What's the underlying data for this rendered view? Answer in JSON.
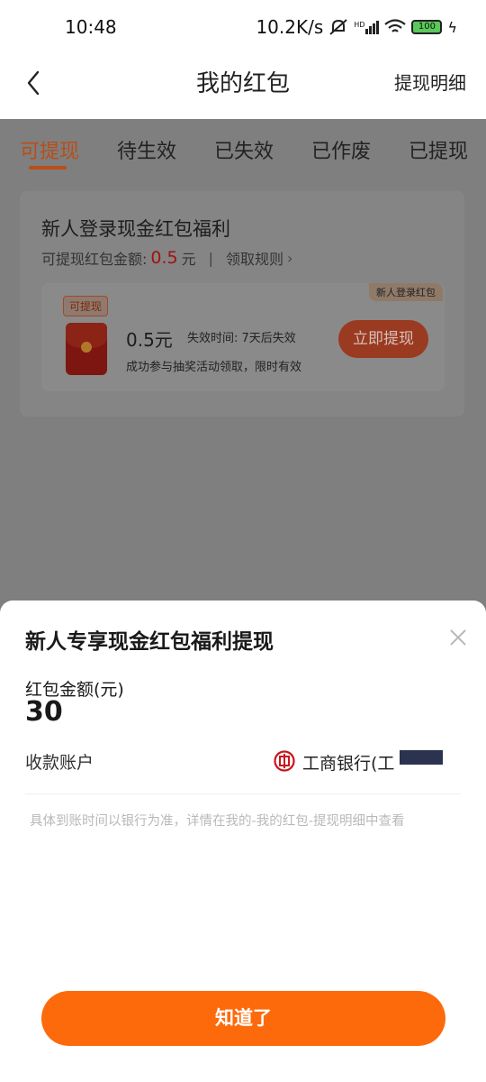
{
  "status_bar": {
    "time": "10:48",
    "network_speed": "10.2K/s",
    "hd_label": "HD",
    "battery": "100"
  },
  "header": {
    "title": "我的红包",
    "action": "提现明细"
  },
  "tabs": [
    {
      "label": "可提现",
      "active": true
    },
    {
      "label": "待生效"
    },
    {
      "label": "已失效"
    },
    {
      "label": "已作废"
    },
    {
      "label": "已提现"
    }
  ],
  "bonus_card": {
    "title": "新人登录现金红包福利",
    "amount_label": "可提现红包金额:",
    "amount": "0.5",
    "unit": "元",
    "divider": "|",
    "rules_link": "领取规则",
    "chevron": "›",
    "coupon": {
      "status_tag": "可提现",
      "corner_tag": "新人登录红包",
      "amount": "0.5元",
      "expire": "失效时间: 7天后失效",
      "desc": "成功参与抽奖活动领取，限时有效",
      "button": "立即提现"
    }
  },
  "sheet": {
    "title": "新人专享现金红包福利提现",
    "amount_label": "红包金额(元)",
    "amount_value": "30",
    "account_label": "收款账户",
    "bank_name": "工商银行(工",
    "notice": "具体到账时间以银行为准，详情在我的-我的红包-提现明细中查看",
    "confirm_button": "知道了"
  },
  "colors": {
    "accent": "#fd6a0b",
    "active_tab": "#b84e19",
    "overlay": "#7f7f7f",
    "amount_red": "#a3110f"
  }
}
